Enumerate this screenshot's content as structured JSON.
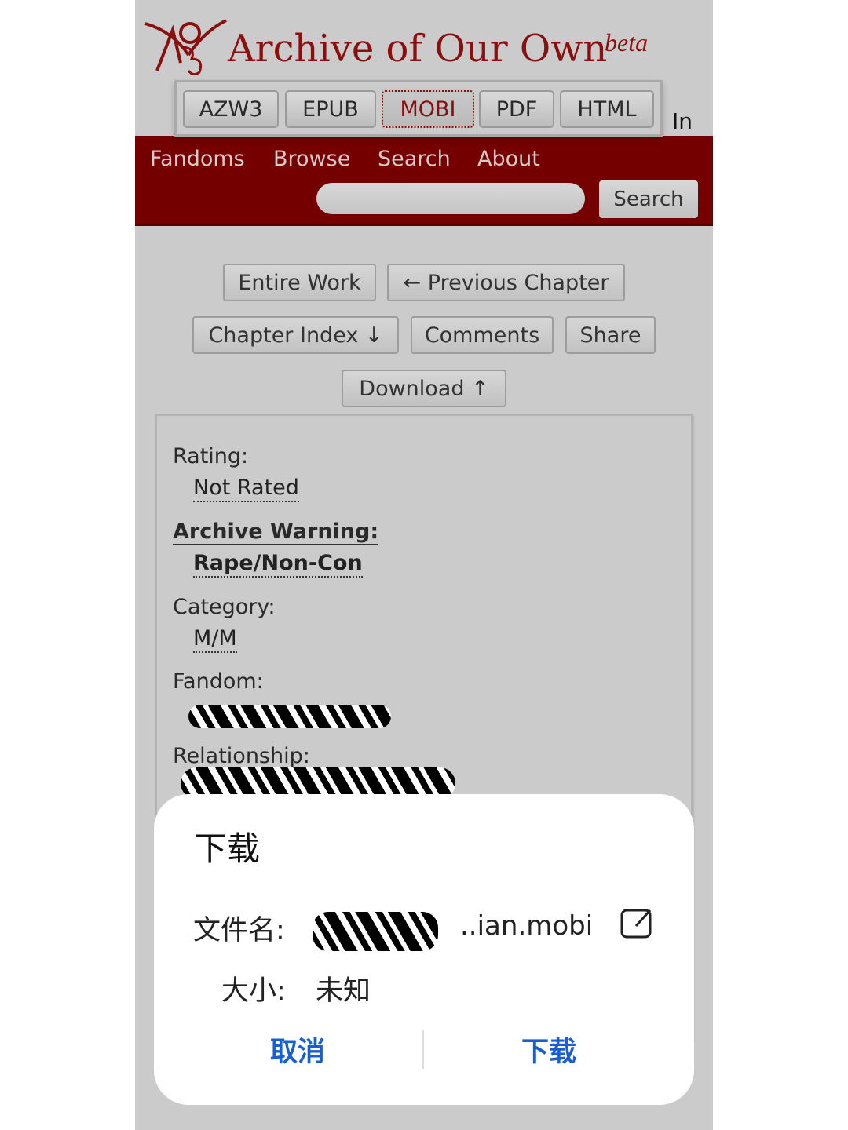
{
  "header": {
    "site_title": "Archive of Our Own",
    "beta": "beta",
    "login_partial": "In"
  },
  "formats": [
    {
      "label": "AZW3"
    },
    {
      "label": "EPUB"
    },
    {
      "label": "MOBI",
      "selected": true
    },
    {
      "label": "PDF"
    },
    {
      "label": "HTML"
    }
  ],
  "nav": {
    "items": [
      "Fandoms",
      "Browse",
      "Search",
      "About"
    ],
    "search_value": "",
    "search_button": "Search"
  },
  "actions": {
    "entire_work": "Entire Work",
    "previous_chapter": "← Previous Chapter",
    "chapter_index": "Chapter Index ↓",
    "comments": "Comments",
    "share": "Share",
    "download": "Download ↑"
  },
  "meta": {
    "rating_label": "Rating:",
    "rating_value": "Not Rated",
    "warning_label": "Archive Warning:",
    "warning_value": "Rape/Non-Con",
    "category_label": "Category:",
    "category_value": "M/M",
    "fandom_label": "Fandom:",
    "relationship_label": "Relationship:"
  },
  "dialog": {
    "title": "下载",
    "filename_label": "文件名:",
    "filename_visible": "..ian.mobi",
    "size_label": "大小:",
    "size_value": "未知",
    "cancel": "取消",
    "confirm": "下载"
  },
  "colors": {
    "brand": "#8a1010",
    "navbar": "#740000",
    "dialog_button": "#1a5fd0"
  }
}
